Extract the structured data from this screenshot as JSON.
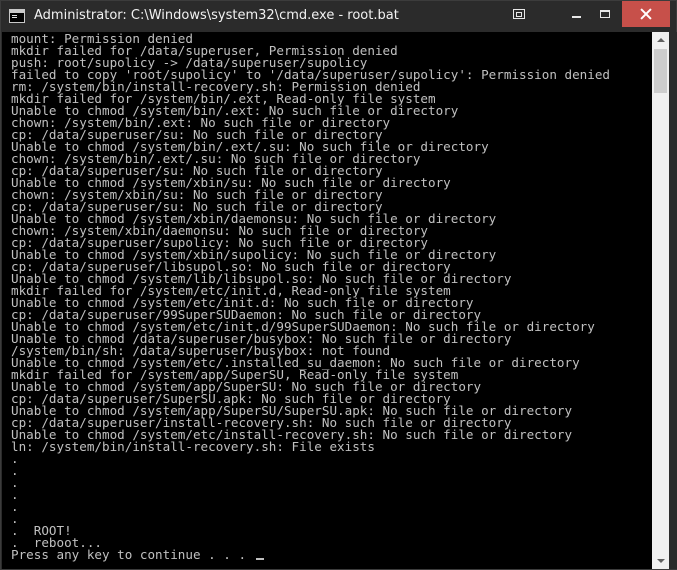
{
  "window": {
    "title": "Administrator: C:\\Windows\\system32\\cmd.exe - root.bat"
  },
  "titlebar": {
    "app_icon": "console-icon",
    "restore_icon": "restore-window-icon",
    "minimize_icon": "minimize-icon",
    "maximize_icon": "maximize-icon",
    "close_icon": "close-icon",
    "close_color": "#c7504a"
  },
  "console": {
    "background": "#000000",
    "foreground": "#c0c0c0",
    "lines": [
      "mount: Permission denied",
      "mkdir failed for /data/superuser, Permission denied",
      "push: root/supolicy -> /data/superuser/supolicy",
      "failed to copy 'root/supolicy' to '/data/superuser/supolicy': Permission denied",
      "rm: /system/bin/install-recovery.sh: Permission denied",
      "mkdir failed for /system/bin/.ext, Read-only file system",
      "Unable to chmod /system/bin/.ext: No such file or directory",
      "chown: /system/bin/.ext: No such file or directory",
      "cp: /data/superuser/su: No such file or directory",
      "Unable to chmod /system/bin/.ext/.su: No such file or directory",
      "chown: /system/bin/.ext/.su: No such file or directory",
      "cp: /data/superuser/su: No such file or directory",
      "Unable to chmod /system/xbin/su: No such file or directory",
      "chown: /system/xbin/su: No such file or directory",
      "cp: /data/superuser/su: No such file or directory",
      "Unable to chmod /system/xbin/daemonsu: No such file or directory",
      "chown: /system/xbin/daemonsu: No such file or directory",
      "cp: /data/superuser/supolicy: No such file or directory",
      "Unable to chmod /system/xbin/supolicy: No such file or directory",
      "cp: /data/superuser/libsupol.so: No such file or directory",
      "Unable to chmod /system/lib/libsupol.so: No such file or directory",
      "mkdir failed for /system/etc/init.d, Read-only file system",
      "Unable to chmod /system/etc/init.d: No such file or directory",
      "cp: /data/superuser/99SuperSUDaemon: No such file or directory",
      "Unable to chmod /system/etc/init.d/99SuperSUDaemon: No such file or directory",
      "Unable to chmod /data/superuser/busybox: No such file or directory",
      "/system/bin/sh: /data/superuser/busybox: not found",
      "Unable to chmod /system/etc/.installed_su_daemon: No such file or directory",
      "mkdir failed for /system/app/SuperSU, Read-only file system",
      "Unable to chmod /system/app/SuperSU: No such file or directory",
      "cp: /data/superuser/SuperSU.apk: No such file or directory",
      "Unable to chmod /system/app/SuperSU/SuperSU.apk: No such file or directory",
      "cp: /data/superuser/install-recovery.sh: No such file or directory",
      "Unable to chmod /system/etc/install-recovery.sh: No such file or directory",
      "ln: /system/bin/install-recovery.sh: File exists",
      ".",
      ".",
      ".",
      ".",
      ".",
      ".",
      ".  ROOT!",
      ".  reboot...",
      "Press any key to continue . . . "
    ]
  },
  "scrollbar": {
    "up_icon": "scroll-up-arrow-icon",
    "down_icon": "scroll-down-arrow-icon",
    "position": 0.0
  }
}
